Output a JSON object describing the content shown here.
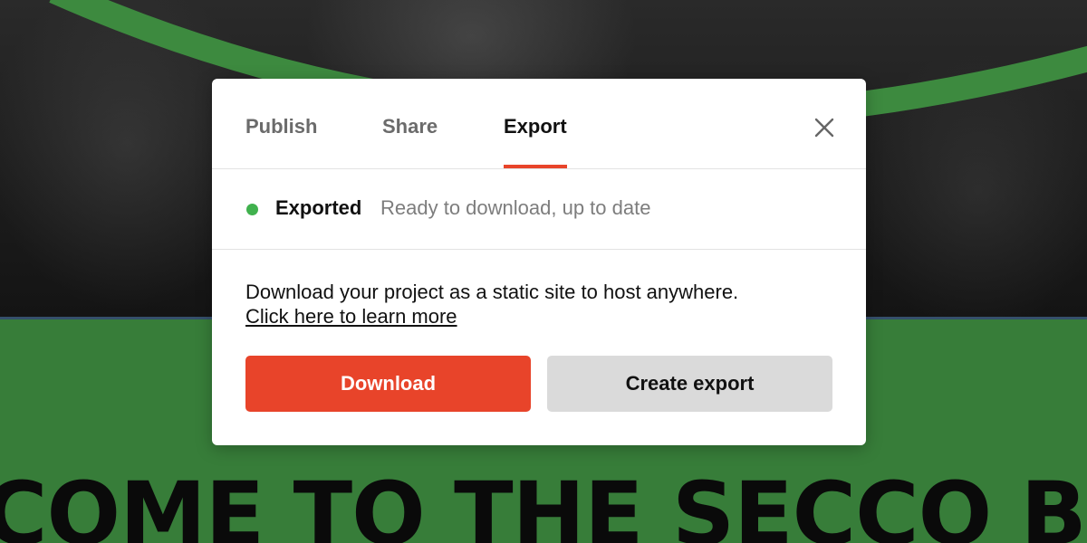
{
  "modal": {
    "tabs": [
      {
        "label": "Publish",
        "active": false
      },
      {
        "label": "Share",
        "active": false
      },
      {
        "label": "Export",
        "active": true
      }
    ],
    "close_icon": "close-icon",
    "status": {
      "label": "Exported",
      "description": "Ready to download, up to date",
      "color": "#40b14e"
    },
    "body_text": "Download your project as a static site to host anywhere.",
    "learn_more_link": "Click here to learn more",
    "buttons": {
      "download": "Download",
      "create_export": "Create export"
    }
  },
  "background": {
    "headline": "COME TO THE SECCO BR",
    "accent_color": "#377d39"
  },
  "colors": {
    "primary": "#e8442a",
    "secondary_button": "#dadada",
    "active_tab_indicator": "#e8442a"
  }
}
